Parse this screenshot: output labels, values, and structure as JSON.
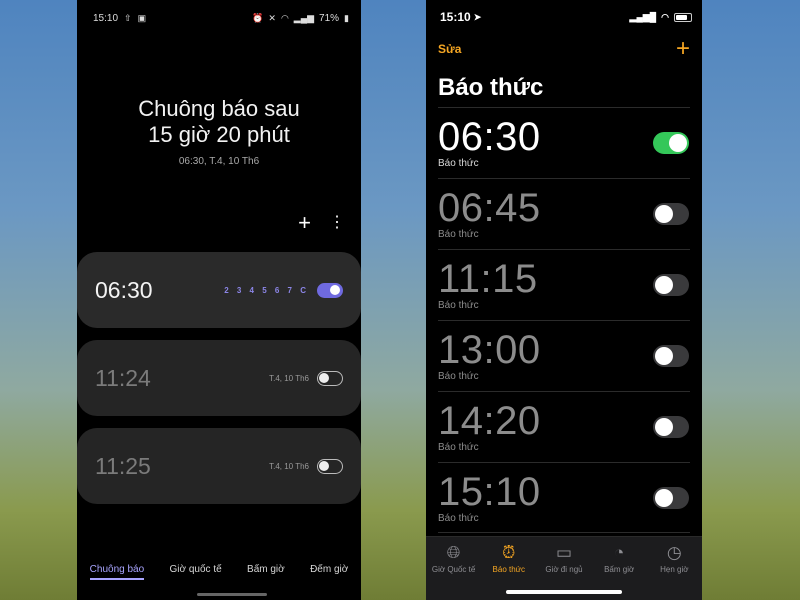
{
  "android": {
    "status": {
      "time": "15:10",
      "battery": "71%"
    },
    "hero": {
      "line1": "Chuông báo sau",
      "line2": "15 giờ 20 phút",
      "sub": "06:30, T.4, 10 Th6"
    },
    "tools": {
      "add_icon": "plus-icon",
      "more_icon": "more-vertical-icon",
      "add_label": "+",
      "more_label": "⋮"
    },
    "alarms": [
      {
        "time": "06:30",
        "detail": "2 3 4 5 6 7 C",
        "on": true
      },
      {
        "time": "11:24",
        "detail": "T.4, 10 Th6",
        "on": false
      },
      {
        "time": "11:25",
        "detail": "T.4, 10 Th6",
        "on": false
      }
    ],
    "nav": {
      "alarm": "Chuông báo",
      "world": "Giờ quốc tế",
      "stopwatch": "Bấm giờ",
      "timer": "Đếm giờ"
    },
    "accent": "#6f6ae0"
  },
  "ios": {
    "status": {
      "time": "15:10"
    },
    "edit_label": "Sửa",
    "add_label": "+",
    "title": "Báo thức",
    "alarms": [
      {
        "time": "06:30",
        "label": "Báo thức",
        "on": true
      },
      {
        "time": "06:45",
        "label": "Báo thức",
        "on": false
      },
      {
        "time": "11:15",
        "label": "Báo thức",
        "on": false
      },
      {
        "time": "13:00",
        "label": "Báo thức",
        "on": false
      },
      {
        "time": "14:20",
        "label": "Báo thức",
        "on": false
      },
      {
        "time": "15:10",
        "label": "Báo thức",
        "on": false
      }
    ],
    "tabs": {
      "world": "Giờ Quốc tế",
      "alarm": "Báo thức",
      "bedtime": "Giờ đi ngủ",
      "stopwatch": "Bấm giờ",
      "timer": "Hẹn giờ"
    },
    "accent": "#f5a623",
    "toggle_on_color": "#34c759"
  }
}
